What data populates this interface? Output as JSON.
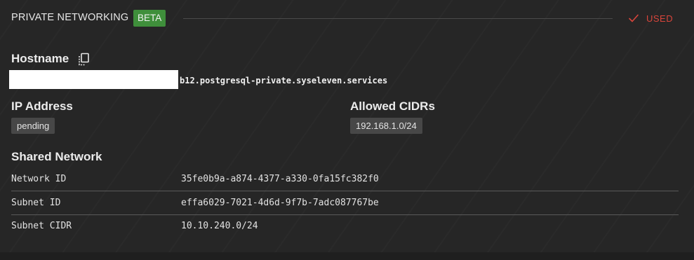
{
  "header": {
    "title": "PRIVATE NETWORKING",
    "badge": "BETA",
    "status_label": "USED",
    "status_icon": "check-icon",
    "status_color": "#d9453b",
    "badge_color": "#3f8f3b"
  },
  "hostname": {
    "label": "Hostname",
    "copy_icon": "copy-icon",
    "value": "b12.postgresql-private.syseleven.services"
  },
  "ip_address": {
    "label": "IP Address",
    "value": "pending"
  },
  "allowed_cidrs": {
    "label": "Allowed CIDRs",
    "values": [
      "192.168.1.0/24"
    ]
  },
  "shared_network": {
    "label": "Shared Network",
    "rows": [
      {
        "key": "Network ID",
        "value": "35fe0b9a-a874-4377-a330-0fa15fc382f0"
      },
      {
        "key": "Subnet ID",
        "value": "effa6029-7021-4d6d-9f7b-7adc087767be"
      },
      {
        "key": "Subnet CIDR",
        "value": "10.10.240.0/24"
      }
    ]
  }
}
